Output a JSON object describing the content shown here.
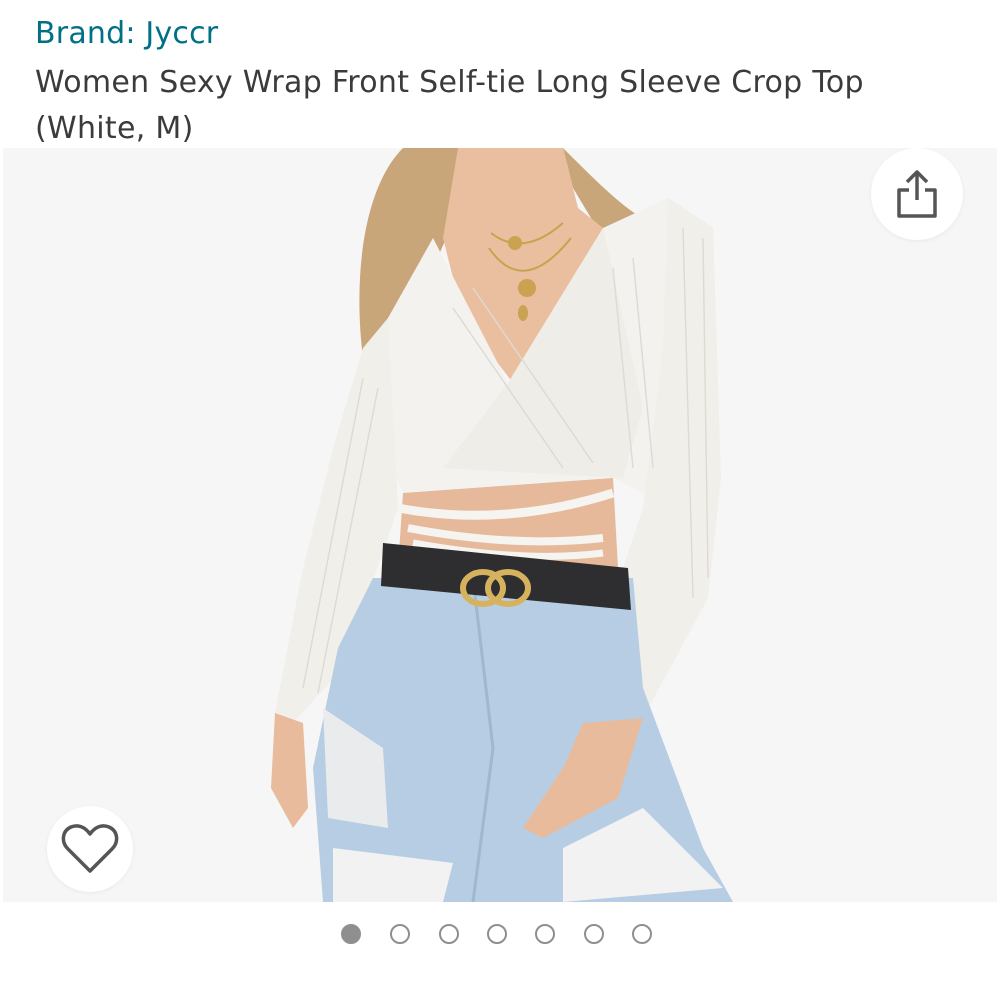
{
  "product": {
    "brand_label": "Brand: Jyccr",
    "title": "Women Sexy Wrap Front Self-tie Long Sleeve Crop Top (White, M)"
  },
  "gallery": {
    "image_count": 7,
    "active_index": 0,
    "share_icon": "share-icon",
    "wishlist_icon": "heart-outline-icon"
  },
  "colors": {
    "brand_link": "#007185",
    "dot": "#8f8f8f"
  }
}
